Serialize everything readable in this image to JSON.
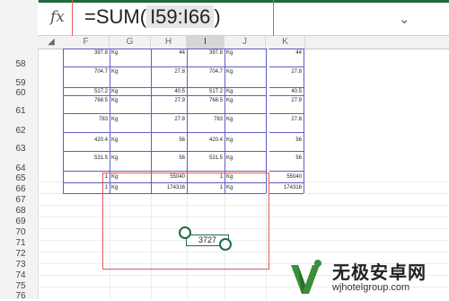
{
  "formula_bar": {
    "fx_label": "fx",
    "prefix": "=SUM(",
    "reference": "I59:I66",
    "suffix": ")",
    "expand_icon": "⌄"
  },
  "column_headers": [
    "F",
    "G",
    "H",
    "I",
    "J",
    "K"
  ],
  "row_headers": [
    "58",
    "59",
    "60",
    "61",
    "62",
    "63",
    "64",
    "65",
    "66",
    "67",
    "68",
    "69",
    "70",
    "71",
    "72",
    "73",
    "74",
    "75",
    "76"
  ],
  "rows": [
    {
      "f": "397.8",
      "g": "Kg",
      "h": "44",
      "i": "397.8",
      "j": "Kg",
      "k": "44"
    },
    {
      "f": "704.7",
      "g": "Kg",
      "h": "27.8",
      "i": "704.7",
      "j": "Kg",
      "k": "27.8"
    },
    {
      "f": "517.2",
      "g": "Kg",
      "h": "40.5",
      "i": "517.2",
      "j": "Kg",
      "k": "40.5"
    },
    {
      "f": "768.5",
      "g": "Kg",
      "h": "27.9",
      "i": "768.5",
      "j": "Kg",
      "k": "27.9"
    },
    {
      "f": "783",
      "g": "Kg",
      "h": "27.8",
      "i": "783",
      "j": "Kg",
      "k": "27.8"
    },
    {
      "f": "420.4",
      "g": "Kg",
      "h": "56",
      "i": "420.4",
      "j": "Kg",
      "k": "56"
    },
    {
      "f": "531.5",
      "g": "Kg",
      "h": "56",
      "i": "531.5",
      "j": "Kg",
      "k": "56"
    },
    {
      "f": "1",
      "g": "Kg",
      "h": "55040",
      "i": "1",
      "j": "Kg",
      "k": "55040"
    },
    {
      "f": "1",
      "g": "Kg",
      "h": "174316",
      "i": "1",
      "j": "Kg",
      "k": "174316"
    }
  ],
  "sum_result": "3727",
  "watermark": {
    "title": "无极安卓网",
    "url": "wjhotelgroup.com"
  },
  "colors": {
    "accent_green": "#1e6b3f",
    "highlight_red": "#e2595e",
    "border_blue": "#5e5ec4"
  }
}
